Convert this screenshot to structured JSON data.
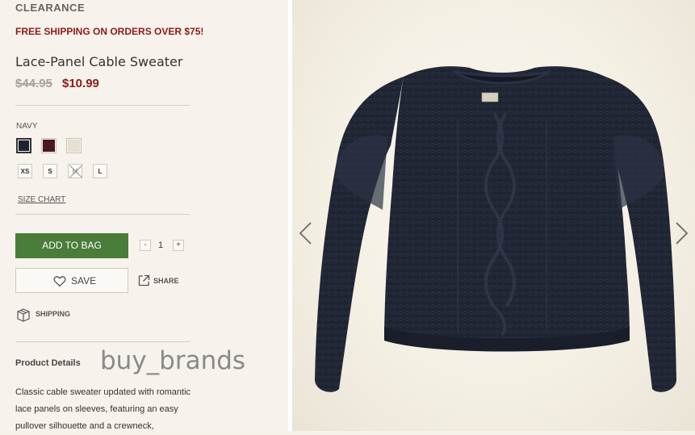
{
  "product": {
    "badge": "CLEARANCE",
    "promo": "FREE SHIPPING ON ORDERS OVER $75!",
    "title": "Lace-Panel Cable Sweater",
    "price_original": "$44.95",
    "price_sale": "$10.99"
  },
  "color": {
    "selected_label": "NAVY",
    "swatches": [
      {
        "name": "navy",
        "hex": "#1d2230"
      },
      {
        "name": "burgundy",
        "hex": "#4a1822"
      },
      {
        "name": "cream",
        "hex": "#e6dfd2"
      }
    ]
  },
  "sizes": [
    {
      "label": "XS",
      "available": true
    },
    {
      "label": "S",
      "available": true
    },
    {
      "label": "M",
      "available": false
    },
    {
      "label": "L",
      "available": true
    }
  ],
  "size_chart_link": "SIZE CHART",
  "actions": {
    "add_to_bag": "ADD TO BAG",
    "qty_minus": "-",
    "quantity": "1",
    "qty_plus": "+",
    "save": "SAVE",
    "share": "SHARE",
    "shipping": "SHIPPING"
  },
  "details": {
    "heading": "Product Details",
    "description": "Classic cable sweater updated with romantic lace panels on sleeves, featuring an easy pullover silhouette and a crewneck,"
  },
  "watermark": "buy_brands",
  "colors": {
    "sale_red": "#8d1a1a",
    "button_green": "#4a7c3a",
    "sweater_navy": "#1f2433"
  },
  "icons": {
    "heart": "heart-icon",
    "share": "share-icon",
    "shipping": "box-icon",
    "prev": "chevron-left-icon",
    "next": "chevron-right-icon"
  }
}
